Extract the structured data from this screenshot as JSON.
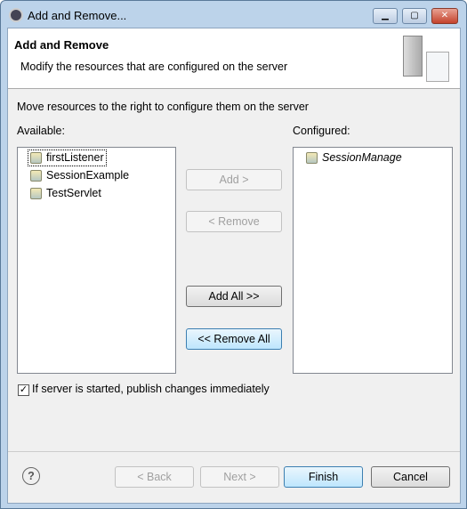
{
  "window": {
    "title": "Add and Remove..."
  },
  "header": {
    "title": "Add and Remove",
    "description": "Modify the resources that are configured on the server"
  },
  "instruction": "Move resources to the right to configure them on the server",
  "available": {
    "label": "Available:",
    "items": [
      "firstListener",
      "SessionExample",
      "TestServlet"
    ]
  },
  "configured": {
    "label": "Configured:",
    "items": [
      "SessionManage"
    ]
  },
  "buttons": {
    "add": "Add >",
    "remove": "< Remove",
    "add_all": "Add All >>",
    "remove_all": "<< Remove All",
    "back": "< Back",
    "next": "Next >",
    "finish": "Finish",
    "cancel": "Cancel"
  },
  "publish": {
    "label": "If server is started, publish changes immediately",
    "checked": true
  }
}
